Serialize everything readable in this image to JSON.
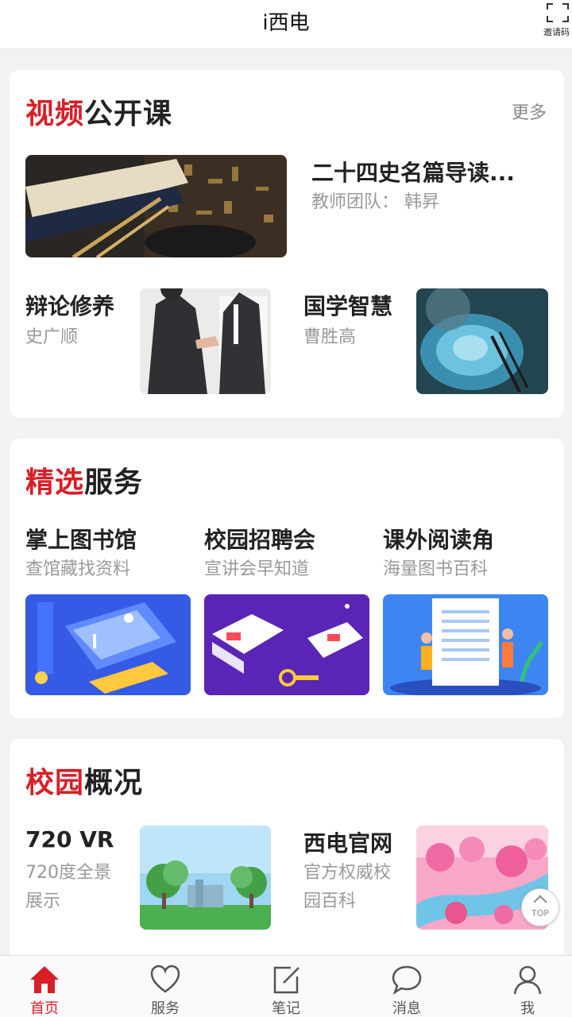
{
  "header": {
    "title": "i西电",
    "scan_label": "邀请码"
  },
  "video_section": {
    "title_red": "视频",
    "title_rest": "公开课",
    "more": "更多",
    "featured": {
      "title": "二十四史名篇导读...",
      "teacher": "教师团队：  韩昇"
    },
    "courses": [
      {
        "title": "辩论修养",
        "teacher": "史广顺"
      },
      {
        "title": "国学智慧",
        "teacher": "曹胜高"
      }
    ]
  },
  "service_section": {
    "title_red": "精选",
    "title_rest": "服务",
    "items": [
      {
        "title": "掌上图书馆",
        "desc": "查馆藏找资料"
      },
      {
        "title": "校园招聘会",
        "desc": "宣讲会早知道"
      },
      {
        "title": "课外阅读角",
        "desc": "海量图书百科"
      }
    ]
  },
  "campus_section": {
    "title_red": "校园",
    "title_rest": "概况",
    "items": [
      {
        "title": "720 VR",
        "desc_line1": "720度全景",
        "desc_line2": "展示"
      },
      {
        "title": "西电官网",
        "desc_line1": "官方权威校",
        "desc_line2": "园百科"
      }
    ]
  },
  "top_button": "TOP",
  "tabbar": {
    "items": [
      {
        "label": "首页",
        "icon": "home-icon",
        "active": true
      },
      {
        "label": "服务",
        "icon": "heart-icon",
        "active": false
      },
      {
        "label": "笔记",
        "icon": "note-edit-icon",
        "active": false
      },
      {
        "label": "消息",
        "icon": "chat-bubble-icon",
        "active": false
      },
      {
        "label": "我",
        "icon": "user-icon",
        "active": false
      }
    ]
  },
  "colors": {
    "accent": "#d81e26",
    "text": "#222222",
    "muted": "#999999",
    "page_bg": "#f2f2f4"
  }
}
